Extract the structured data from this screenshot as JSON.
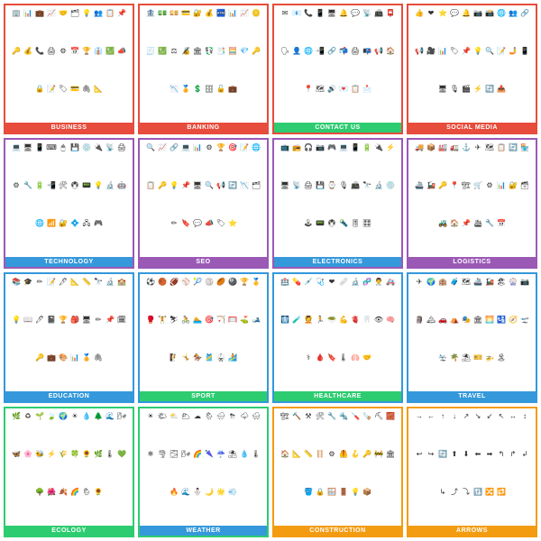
{
  "cards": [
    {
      "id": "business",
      "label": "BUSINESS",
      "borderClass": "card-business",
      "labelClass": "lbl-business",
      "icons": [
        "🏢",
        "📊",
        "💼",
        "📈",
        "🤝",
        "🗂",
        "💡",
        "👥",
        "📋",
        "📌",
        "🔑",
        "💰",
        "📞",
        "🖨",
        "⚙",
        "📅",
        "🏆",
        "👔",
        "💹",
        "📣",
        "🔒",
        "📝",
        "🏷",
        "💳",
        "🖇",
        "📐"
      ]
    },
    {
      "id": "banking",
      "label": "BANKING",
      "borderClass": "card-banking",
      "labelClass": "lbl-banking",
      "icons": [
        "🏦",
        "💵",
        "💴",
        "💳",
        "🔐",
        "💰",
        "🏧",
        "📊",
        "📈",
        "🪙",
        "🧾",
        "💹",
        "⚖",
        "🔏",
        "🏛",
        "💱",
        "📑",
        "🧮",
        "💎",
        "🔑",
        "📉",
        "🏅",
        "💲",
        "🗄",
        "🔓",
        "💼"
      ]
    },
    {
      "id": "contact",
      "label": "CONTACT US",
      "borderClass": "card-contact",
      "labelClass": "lbl-contact",
      "icons": [
        "✉",
        "📧",
        "📞",
        "📱",
        "🖥",
        "🔔",
        "💬",
        "📡",
        "📠",
        "📮",
        "🗣",
        "👤",
        "🌐",
        "📲",
        "🔗",
        "📬",
        "🖨",
        "📭",
        "📢",
        "🏠",
        "📍",
        "🗺",
        "🔊",
        "💌",
        "📋",
        "📩"
      ]
    },
    {
      "id": "social",
      "label": "SOCIAL MEDIA",
      "borderClass": "card-social",
      "labelClass": "lbl-social",
      "icons": [
        "👍",
        "❤",
        "⭐",
        "💬",
        "🔔",
        "📷",
        "📸",
        "🌐",
        "👥",
        "🔗",
        "📢",
        "🎥",
        "📊",
        "🏷",
        "📌",
        "💡",
        "🔍",
        "📝",
        "🤳",
        "📱",
        "🖥",
        "🎙",
        "🎬",
        "⚡",
        "🔄",
        "📤"
      ]
    },
    {
      "id": "technology",
      "label": "TECHNOLOGY",
      "borderClass": "card-technology",
      "labelClass": "lbl-technology",
      "icons": [
        "💻",
        "🖥",
        "📱",
        "⌨",
        "🖱",
        "💾",
        "💿",
        "🔌",
        "📡",
        "🖨",
        "⚙",
        "🔧",
        "🔋",
        "📲",
        "🛠",
        "🖲",
        "📟",
        "💡",
        "🔬",
        "🤖",
        "🌐",
        "📶",
        "🔐",
        "💠",
        "🖧",
        "🎮"
      ]
    },
    {
      "id": "seo",
      "label": "SEO",
      "borderClass": "card-seo",
      "labelClass": "lbl-seo",
      "icons": [
        "🔍",
        "📈",
        "🔗",
        "💻",
        "📊",
        "⚙",
        "🏆",
        "🎯",
        "📝",
        "🌐",
        "📋",
        "🔑",
        "💡",
        "📌",
        "🖥",
        "🔍",
        "📢",
        "🔄",
        "📉",
        "🗂",
        "✏",
        "🔖",
        "💬",
        "📣",
        "🏷",
        "⭐"
      ]
    },
    {
      "id": "electronics",
      "label": "ELECTRONICS",
      "borderClass": "card-electronics",
      "labelClass": "lbl-electronics",
      "icons": [
        "📺",
        "📻",
        "🎧",
        "📷",
        "🎮",
        "💻",
        "📱",
        "🔋",
        "🔌",
        "⚡",
        "🖥",
        "📡",
        "🖨",
        "💾",
        "⌚",
        "🎙",
        "📠",
        "🔭",
        "🔬",
        "💿",
        "🕹",
        "📟",
        "🖲",
        "🔦",
        "🎚",
        "🎛"
      ]
    },
    {
      "id": "logistics",
      "label": "LOGISTICS",
      "borderClass": "card-logistics",
      "labelClass": "lbl-logistics",
      "icons": [
        "🚚",
        "📦",
        "🏭",
        "🚛",
        "⚓",
        "✈",
        "🗺",
        "📋",
        "🔄",
        "🏪",
        "🚢",
        "🚂",
        "🔑",
        "📍",
        "🏗",
        "🛒",
        "⚙",
        "📊",
        "🔐",
        "🗃",
        "🚜",
        "🏠",
        "📌",
        "🛳",
        "🔧",
        "📅"
      ]
    },
    {
      "id": "education",
      "label": "EDUCATION",
      "borderClass": "card-education",
      "labelClass": "lbl-education",
      "icons": [
        "📚",
        "🎓",
        "✏",
        "📝",
        "🖊",
        "📐",
        "📏",
        "🔭",
        "🔬",
        "🏫",
        "💡",
        "📖",
        "🖊",
        "📓",
        "🏆",
        "🎒",
        "🖥",
        "✏",
        "📌",
        "🗓",
        "🔑",
        "💼",
        "🎨",
        "📊",
        "🏅",
        "🖇"
      ]
    },
    {
      "id": "sport",
      "label": "SPORT",
      "borderClass": "card-sport",
      "labelClass": "lbl-sport",
      "icons": [
        "⚽",
        "🏀",
        "🏈",
        "⚾",
        "🎾",
        "🏐",
        "🏉",
        "🎱",
        "🏆",
        "🥇",
        "🥊",
        "🏋",
        "⛷",
        "🚴",
        "🏊",
        "🎯",
        "🏹",
        "🥅",
        "⛳",
        "🎿",
        "🧗",
        "🤸",
        "🏇",
        "🎽",
        "🥋",
        "🏄"
      ]
    },
    {
      "id": "healthcare",
      "label": "HEALTHCARE",
      "borderClass": "card-healthcare",
      "labelClass": "lbl-healthcare",
      "icons": [
        "🏥",
        "💊",
        "💉",
        "🩺",
        "❤",
        "🩹",
        "🔬",
        "🧬",
        "👨‍⚕",
        "🚑",
        "🩻",
        "🧪",
        "💆",
        "🏃",
        "🥗",
        "💪",
        "🫀",
        "🦷",
        "👁",
        "🧠",
        "⚕",
        "🩸",
        "🔖",
        "🌡",
        "🫁",
        "🤝"
      ]
    },
    {
      "id": "travel",
      "label": "TRAVEL",
      "borderClass": "card-travel",
      "labelClass": "lbl-travel",
      "icons": [
        "✈",
        "🌍",
        "🏨",
        "🧳",
        "🗺",
        "🚢",
        "🚂",
        "🏖",
        "🎡",
        "📷",
        "🗿",
        "🏔",
        "🚗",
        "⛺",
        "🎭",
        "🏛",
        "🌅",
        "🛂",
        "🧭",
        "🛫",
        "🛬",
        "🌴",
        "⛱",
        "🎫",
        "🚁",
        "🏝"
      ]
    },
    {
      "id": "ecology",
      "label": "ECOLOGY",
      "borderClass": "card-ecology",
      "labelClass": "lbl-ecology",
      "icons": [
        "🌿",
        "♻",
        "🌱",
        "🍃",
        "🌍",
        "☀",
        "💧",
        "🌲",
        "🌊",
        "🌬",
        "🦋",
        "🌸",
        "🐝",
        "⚡",
        "🌾",
        "🍀",
        "🌻",
        "🌿",
        "🌡",
        "💚",
        "🌳",
        "🌺",
        "🍂",
        "🌈",
        "🌦",
        "🌻"
      ]
    },
    {
      "id": "weather",
      "label": "WEATHER",
      "borderClass": "card-weather",
      "labelClass": "lbl-weather",
      "icons": [
        "☀",
        "🌤",
        "⛅",
        "🌥",
        "☁",
        "🌦",
        "🌧",
        "⛈",
        "🌩",
        "🌨",
        "❄",
        "🌪",
        "🌫",
        "🌬",
        "🌈",
        "🌂",
        "☔",
        "⛱",
        "💧",
        "🌡",
        "🔥",
        "🌊",
        "⛄",
        "🌙",
        "🌟",
        "💨"
      ]
    },
    {
      "id": "construction",
      "label": "CONSTRUCTION",
      "borderClass": "card-construction",
      "labelClass": "lbl-construction",
      "icons": [
        "🏗",
        "🔨",
        "⚒",
        "🛠",
        "🔧",
        "🔩",
        "🪛",
        "🪚",
        "⛏",
        "🧱",
        "🏠",
        "📐",
        "📏",
        "🪜",
        "⚙",
        "🦺",
        "🪝",
        "🔑",
        "🚧",
        "🏛",
        "🪣",
        "🔒",
        "🪟",
        "🚪",
        "💡",
        "📦"
      ]
    },
    {
      "id": "arrows",
      "label": "ARROWS",
      "borderClass": "card-arrows",
      "labelClass": "lbl-arrows",
      "icons": [
        "→",
        "←",
        "↑",
        "↓",
        "↗",
        "↘",
        "↙",
        "↖",
        "↔",
        "↕",
        "↩",
        "↪",
        "🔄",
        "⬆",
        "⬇",
        "⬅",
        "➡",
        "↰",
        "↱",
        "↲",
        "↳",
        "⤴",
        "⤵",
        "🔃",
        "🔀",
        "🔁"
      ]
    }
  ]
}
